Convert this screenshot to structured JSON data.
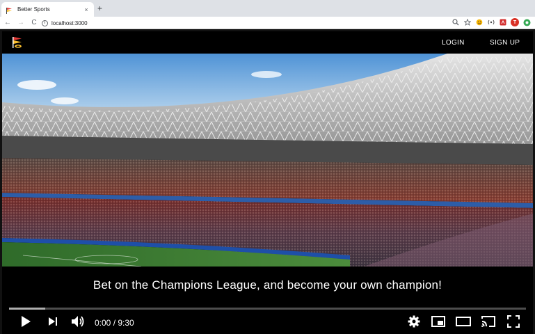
{
  "browser": {
    "tab": {
      "title": "Better Sports",
      "close_glyph": "×"
    },
    "new_tab_glyph": "+",
    "address": {
      "url": "localhost:3000"
    },
    "nav": {
      "back_glyph": "←",
      "forward_glyph": "→",
      "reload_glyph": "C"
    },
    "extension_letter": "T"
  },
  "site": {
    "nav": {
      "login_label": "LOGIN",
      "signup_label": "SIGN UP"
    },
    "tagline": "Bet on the Champions League, and become your own champion!"
  },
  "video": {
    "time_display": "0:00 / 9:30",
    "buffered_fraction": 0.07
  },
  "colors": {
    "accent_red": "#e53935",
    "accent_yellow": "#fbc02d",
    "pitch_green": "#3d7a34"
  },
  "icons": {
    "tab_favicon": "flag-icon",
    "play": "play-icon",
    "next": "next-icon",
    "volume": "volume-icon",
    "settings": "gear-icon",
    "miniplayer": "miniplayer-icon",
    "theater": "theater-icon",
    "cast": "cast-icon",
    "fullscreen": "fullscreen-icon"
  }
}
